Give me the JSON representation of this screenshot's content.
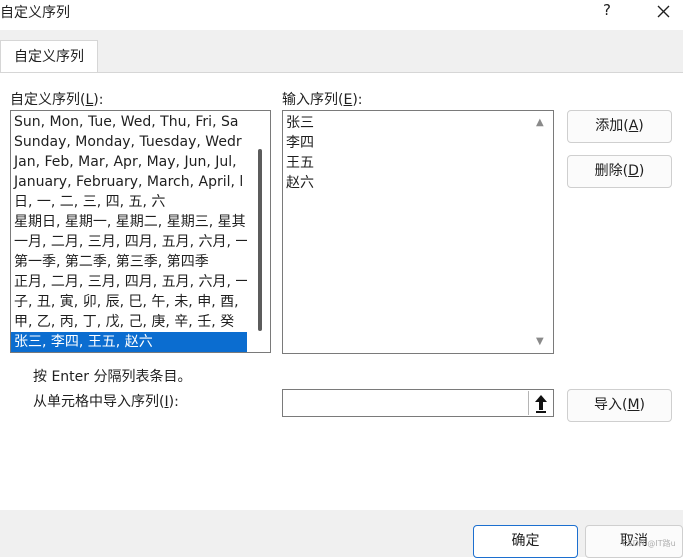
{
  "window": {
    "title": "自定义序列",
    "help_label": "?"
  },
  "tabs": [
    {
      "label": "自定义序列"
    }
  ],
  "left_panel": {
    "label_prefix": "自定义序列(",
    "label_key": "L",
    "label_suffix": "):",
    "items": [
      "Sun, Mon, Tue, Wed, Thu, Fri, Sa",
      "Sunday, Monday, Tuesday, Wedr",
      "Jan, Feb, Mar, Apr, May, Jun, Jul,",
      "January, February, March, April, l",
      "日, 一, 二, 三, 四, 五, 六",
      "星期日, 星期一, 星期二, 星期三, 星其",
      "一月, 二月, 三月, 四月, 五月, 六月, 一",
      "第一季, 第二季, 第三季, 第四季",
      "正月, 二月, 三月, 四月, 五月, 六月, 一",
      "子, 丑, 寅, 卯, 辰, 巳, 午, 未, 申, 酉, ",
      "甲, 乙, 丙, 丁, 戊, 己, 庚, 辛, 壬, 癸",
      "张三, 李四, 王五, 赵六"
    ],
    "selected_index": 11
  },
  "right_panel": {
    "label_prefix": "输入序列(",
    "label_key": "E",
    "label_suffix": "):",
    "entries": [
      "张三",
      "李四",
      "王五",
      "赵六"
    ]
  },
  "buttons": {
    "add": {
      "prefix": "添加(",
      "key": "A",
      "suffix": ")"
    },
    "delete": {
      "prefix": "删除(",
      "key": "D",
      "suffix": ")"
    },
    "import": {
      "prefix": "导入(",
      "key": "M",
      "suffix": ")"
    },
    "ok": "确定",
    "cancel": "取消"
  },
  "hint_text": "按 Enter 分隔列表条目。",
  "import_label": {
    "prefix": "从单元格中导入序列(",
    "key": "I",
    "suffix": "):"
  },
  "import_value": "",
  "watermark": "CSDN @IT路u",
  "colors": {
    "selection": "#0b6dd0",
    "primary_border": "#1c6fcf"
  },
  "icons": {
    "help": "question-mark",
    "close": "close-icon",
    "range_picker": "upload-arrow-icon"
  }
}
